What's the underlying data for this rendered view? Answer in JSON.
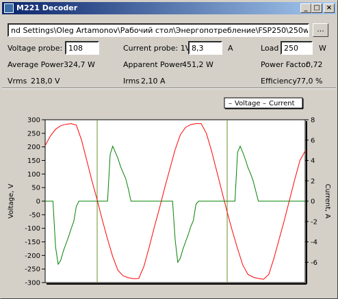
{
  "window": {
    "title": "M221 Decoder",
    "minimize": "_",
    "maximize": "□",
    "close": "×"
  },
  "file": {
    "path": "nd Settings\\Oleg Artamonov\\Рабочий стол\\Энергопотребление\\FSP250\\250w.015",
    "browse_label": "..."
  },
  "controls": {
    "voltage_probe_label": "Voltage probe: 1:",
    "voltage_probe_value": "108",
    "current_probe_label": "Current probe: 1V =",
    "current_probe_value": "8,3",
    "current_probe_unit": "A",
    "load_label": "Load",
    "load_value": "250",
    "load_unit": "W"
  },
  "stats": {
    "average_power_label": "Average Power",
    "average_power_value": "324,7 W",
    "apparent_power_label": "Apparent Power",
    "apparent_power_value": "451,2 W",
    "power_factor_label": "Power Factor",
    "power_factor_value": "0,72",
    "vrms_label": "Vrms",
    "vrms_value": "218,0 V",
    "irms_label": "Irms",
    "irms_value": "2,10 A",
    "efficiency_label": "Efficiency",
    "efficiency_value": "77,0 %"
  },
  "chart_data": {
    "type": "line",
    "legend_placement": "top-right",
    "grid": false,
    "ylabel": "Voltage, V",
    "ylabel_right": "Current, A",
    "ylim": [
      -300,
      300
    ],
    "ylim_right": [
      -8,
      8
    ],
    "y_ticks": [
      "300",
      "250",
      "200",
      "150",
      "100",
      "50",
      "0",
      "-50",
      "-100",
      "-150",
      "-200",
      "-250",
      "-300"
    ],
    "y_right_ticks": [
      "8",
      "6",
      "4",
      "2",
      "0",
      "-2",
      "-4",
      "-6"
    ],
    "series": [
      {
        "name": "Voltage",
        "color": "#ff0000",
        "axis": "left",
        "x": [
          0,
          2,
          4,
          6,
          8,
          10,
          12,
          14,
          16,
          18,
          20,
          22,
          24,
          26,
          28,
          30,
          32,
          34,
          36,
          38,
          40,
          42,
          44,
          46,
          48,
          50,
          52,
          54,
          56,
          58,
          60,
          62,
          64,
          66,
          68,
          70,
          72,
          74,
          76,
          78,
          80,
          82,
          84,
          86,
          88,
          90,
          92,
          94,
          96,
          98,
          100
        ],
        "values": [
          205,
          240,
          265,
          278,
          283,
          286,
          280,
          225,
          150,
          75,
          5,
          -70,
          -140,
          -205,
          -255,
          -275,
          -282,
          -286,
          -285,
          -240,
          -170,
          -95,
          -25,
          50,
          120,
          190,
          245,
          272,
          282,
          286,
          286,
          250,
          185,
          110,
          35,
          -40,
          -110,
          -175,
          -235,
          -270,
          -280,
          -285,
          -288,
          -270,
          -210,
          -140,
          -70,
          5,
          80,
          150,
          185
        ]
      },
      {
        "name": "Current",
        "color": "#008000",
        "axis": "right",
        "x": [
          0,
          1.5,
          3,
          4,
          5,
          6,
          7,
          8,
          9,
          10,
          11,
          12,
          13,
          14,
          15,
          16,
          17,
          18,
          19,
          20,
          21,
          22,
          23,
          24,
          25,
          26,
          27,
          28,
          29,
          30,
          31,
          32,
          33,
          34,
          35,
          36,
          37,
          38,
          39,
          40,
          41,
          42,
          43,
          44,
          45,
          46,
          47,
          48,
          49,
          50,
          51,
          52,
          53,
          54,
          55,
          56,
          57,
          58,
          59,
          60,
          61,
          62,
          63,
          64,
          65,
          66,
          67,
          68,
          69,
          70,
          71,
          72,
          73,
          74,
          75,
          76,
          77,
          78,
          79,
          80,
          81,
          82,
          83,
          84,
          85,
          86,
          87,
          88,
          89,
          90,
          91,
          92,
          93,
          94,
          95,
          96,
          97,
          98,
          99,
          100
        ],
        "values": [
          0,
          0,
          0,
          -4.5,
          -6.2,
          -5.8,
          -4.9,
          -4.2,
          -3.5,
          -2.7,
          -2,
          -0.5,
          0,
          0,
          0,
          0,
          0,
          0,
          0,
          0,
          0,
          0,
          0,
          0,
          4.6,
          5.4,
          4.8,
          4.2,
          3.4,
          2.8,
          2.2,
          1.2,
          0,
          0,
          0,
          0,
          0,
          0,
          0,
          0,
          0,
          0,
          0,
          0,
          0,
          0,
          0,
          0,
          0,
          -3.8,
          -6.0,
          -5.6,
          -4.7,
          -4.0,
          -3.3,
          -2.5,
          -1.9,
          -0.3,
          0,
          0,
          0,
          0,
          0,
          0,
          0,
          0,
          0,
          0,
          0,
          0,
          0,
          0,
          0,
          4.8,
          5.4,
          4.8,
          4.1,
          3.3,
          2.7,
          2.0,
          1.0,
          0,
          0,
          0,
          0,
          0,
          0,
          0,
          0,
          0,
          0,
          0,
          0,
          0,
          0,
          0,
          0,
          0,
          0,
          0
        ]
      }
    ],
    "markers_x": [
      20,
      70
    ]
  }
}
